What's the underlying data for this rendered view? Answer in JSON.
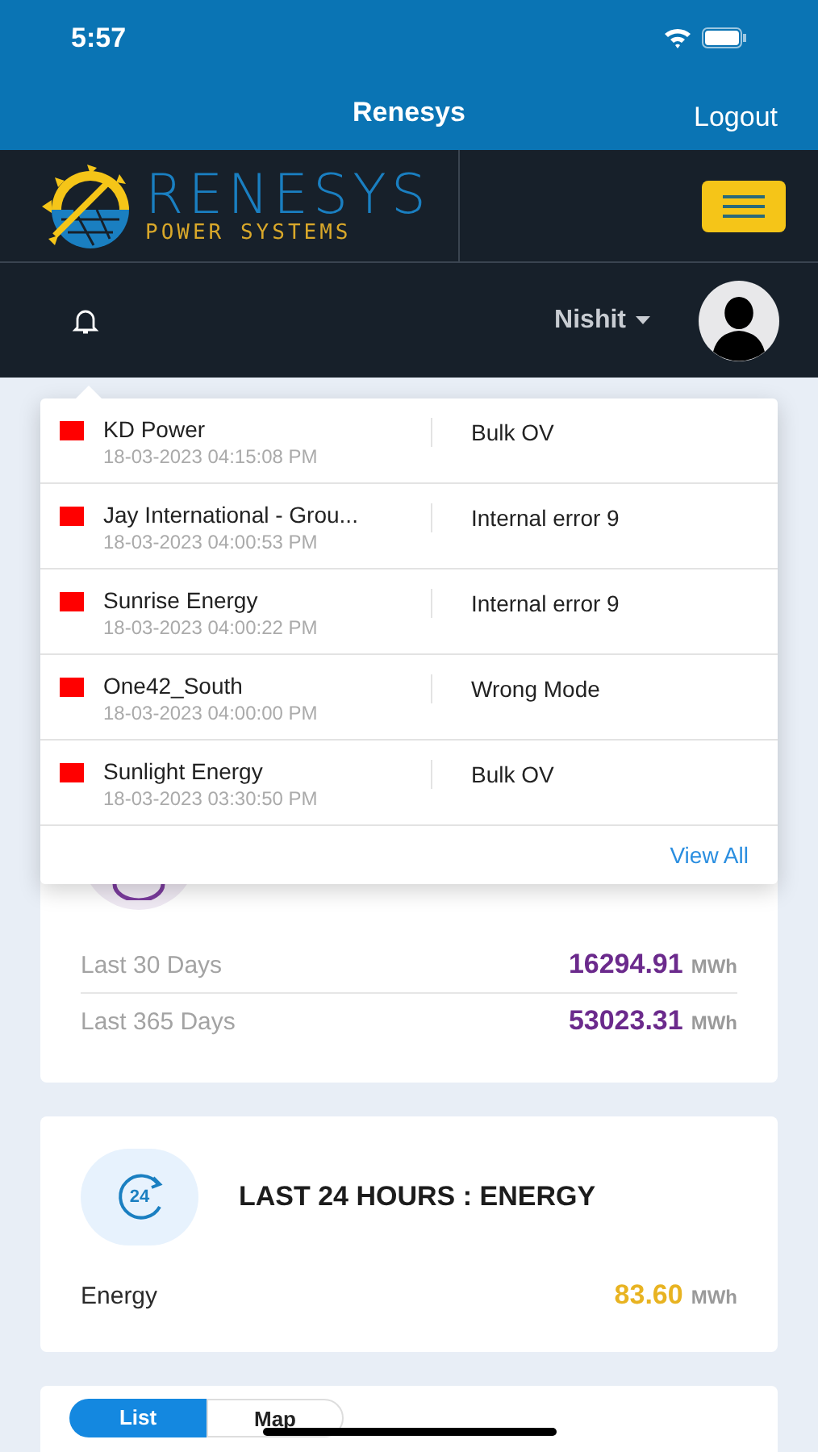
{
  "status_bar": {
    "time": "5:57"
  },
  "header": {
    "title": "Renesys",
    "action": "Logout"
  },
  "logo": {
    "name": "RENESYS",
    "tagline": "POWER SYSTEMS"
  },
  "user_bar": {
    "user": "Nishit"
  },
  "notifications": {
    "items": [
      {
        "site": "KD Power",
        "time": "18-03-2023 04:15:08 PM",
        "alarm": "Bulk OV"
      },
      {
        "site": "Jay International - Grou...",
        "time": "18-03-2023 04:00:53 PM",
        "alarm": "Internal error 9"
      },
      {
        "site": "Sunrise Energy",
        "time": "18-03-2023 04:00:22 PM",
        "alarm": "Internal error 9"
      },
      {
        "site": "One42_South",
        "time": "18-03-2023 04:00:00 PM",
        "alarm": "Wrong Mode"
      },
      {
        "site": "Sunlight Energy",
        "time": "18-03-2023 03:30:50 PM",
        "alarm": "Bulk OV"
      }
    ],
    "view_all": "View All"
  },
  "energy_summary": {
    "rows": [
      {
        "label": "Last 30 Days",
        "value": "16294.91",
        "unit": "MWh"
      },
      {
        "label": "Last 365 Days",
        "value": "53023.31",
        "unit": "MWh"
      }
    ]
  },
  "last_24h": {
    "icon_label": "24",
    "title": "LAST 24 HOURS : ENERGY",
    "rows": [
      {
        "label": "Energy",
        "value": "83.60",
        "unit": "MWh"
      }
    ]
  },
  "view_tabs": [
    {
      "label": "List",
      "selected": true
    },
    {
      "label": "Map",
      "selected": false
    }
  ]
}
